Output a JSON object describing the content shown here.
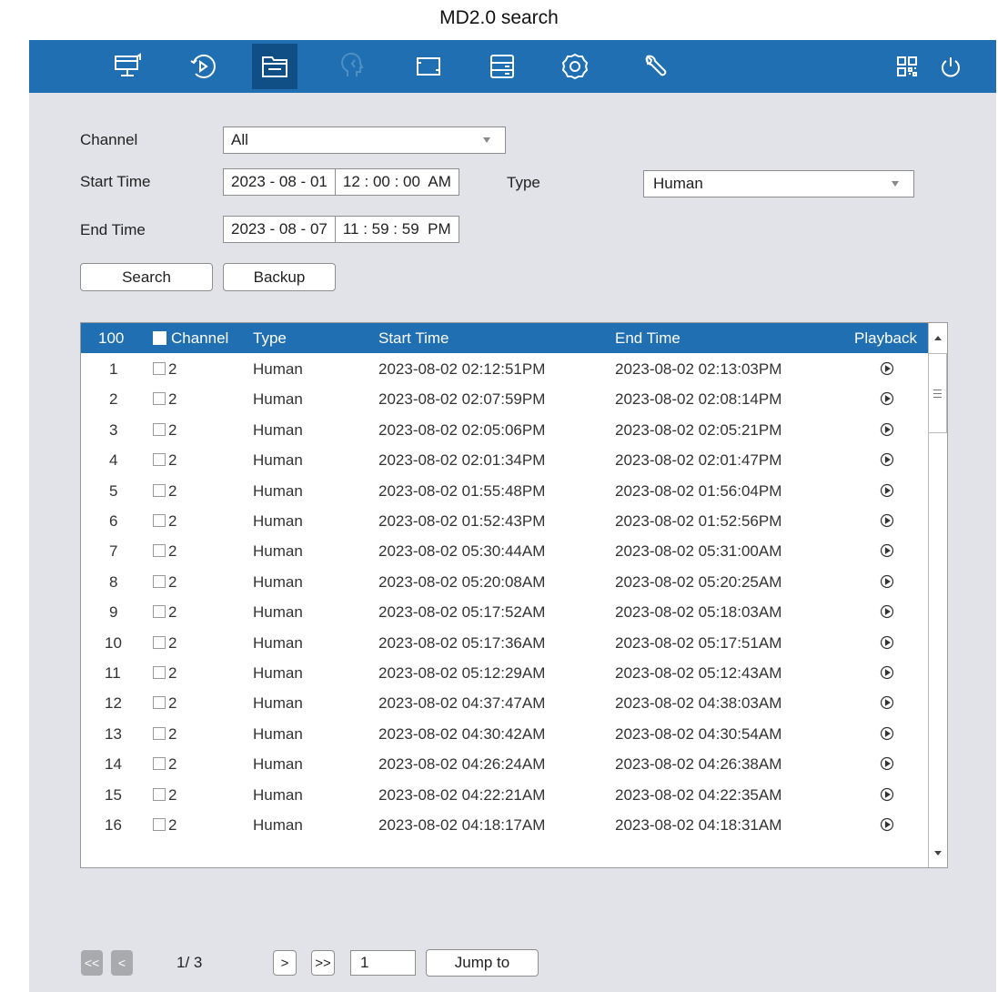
{
  "caption": "MD2.0 search",
  "topbar": {
    "icons": [
      "monitor-icon",
      "playback-icon",
      "file-search-icon",
      "face-icon",
      "camera-icon",
      "storage-icon",
      "settings-icon",
      "maintenance-icon",
      "qr-code-icon",
      "power-icon"
    ],
    "active_icon": "file-search-icon",
    "color": "#1f6fb2"
  },
  "form": {
    "channel_label": "Channel",
    "channel_value": "All",
    "start_label": "Start Time",
    "start_date": "2023 - 08 - 01",
    "start_time": "12 : 00 : 00  AM",
    "type_label": "Type",
    "type_value": "Human",
    "end_label": "End Time",
    "end_date": "2023 - 08 - 07",
    "end_time": "11 : 59 : 59  PM",
    "search_button": "Search",
    "backup_button": "Backup"
  },
  "table": {
    "headers": {
      "count": "100",
      "channel": "Channel",
      "type": "Type",
      "start": "Start Time",
      "end": "End Time",
      "playback": "Playback"
    },
    "rows": [
      {
        "no": "1",
        "ch": "2",
        "type": "Human",
        "start": "2023-08-02 02:12:51PM",
        "end": "2023-08-02 02:13:03PM"
      },
      {
        "no": "2",
        "ch": "2",
        "type": "Human",
        "start": "2023-08-02 02:07:59PM",
        "end": "2023-08-02 02:08:14PM"
      },
      {
        "no": "3",
        "ch": "2",
        "type": "Human",
        "start": "2023-08-02 02:05:06PM",
        "end": "2023-08-02 02:05:21PM"
      },
      {
        "no": "4",
        "ch": "2",
        "type": "Human",
        "start": "2023-08-02 02:01:34PM",
        "end": "2023-08-02 02:01:47PM"
      },
      {
        "no": "5",
        "ch": "2",
        "type": "Human",
        "start": "2023-08-02 01:55:48PM",
        "end": "2023-08-02 01:56:04PM"
      },
      {
        "no": "6",
        "ch": "2",
        "type": "Human",
        "start": "2023-08-02 01:52:43PM",
        "end": "2023-08-02 01:52:56PM"
      },
      {
        "no": "7",
        "ch": "2",
        "type": "Human",
        "start": "2023-08-02 05:30:44AM",
        "end": "2023-08-02 05:31:00AM"
      },
      {
        "no": "8",
        "ch": "2",
        "type": "Human",
        "start": "2023-08-02 05:20:08AM",
        "end": "2023-08-02 05:20:25AM"
      },
      {
        "no": "9",
        "ch": "2",
        "type": "Human",
        "start": "2023-08-02 05:17:52AM",
        "end": "2023-08-02 05:18:03AM"
      },
      {
        "no": "10",
        "ch": "2",
        "type": "Human",
        "start": "2023-08-02 05:17:36AM",
        "end": "2023-08-02 05:17:51AM"
      },
      {
        "no": "11",
        "ch": "2",
        "type": "Human",
        "start": "2023-08-02 05:12:29AM",
        "end": "2023-08-02 05:12:43AM"
      },
      {
        "no": "12",
        "ch": "2",
        "type": "Human",
        "start": "2023-08-02 04:37:47AM",
        "end": "2023-08-02 04:38:03AM"
      },
      {
        "no": "13",
        "ch": "2",
        "type": "Human",
        "start": "2023-08-02 04:30:42AM",
        "end": "2023-08-02 04:30:54AM"
      },
      {
        "no": "14",
        "ch": "2",
        "type": "Human",
        "start": "2023-08-02 04:26:24AM",
        "end": "2023-08-02 04:26:38AM"
      },
      {
        "no": "15",
        "ch": "2",
        "type": "Human",
        "start": "2023-08-02 04:22:21AM",
        "end": "2023-08-02 04:22:35AM"
      },
      {
        "no": "16",
        "ch": "2",
        "type": "Human",
        "start": "2023-08-02 04:18:17AM",
        "end": "2023-08-02 04:18:31AM"
      }
    ]
  },
  "pagination": {
    "first": "<<",
    "prev": "<",
    "page_info": "1/  3",
    "next": ">",
    "last": ">>",
    "page_input": "1",
    "jump_button": "Jump to"
  }
}
